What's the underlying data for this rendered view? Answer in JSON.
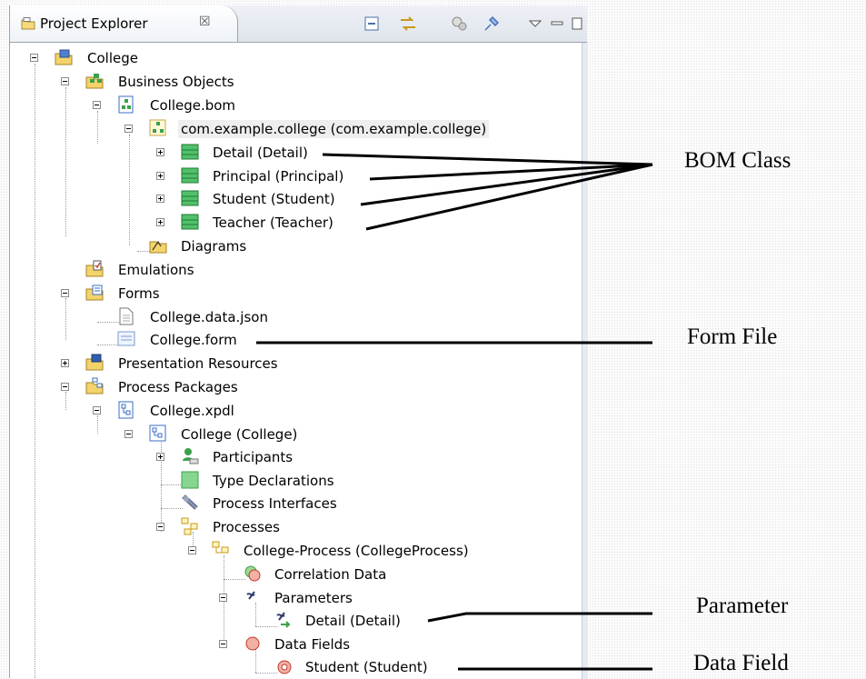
{
  "view": {
    "tab_title": "Project Explorer",
    "close_glyph": "☒"
  },
  "tree": {
    "root": "College",
    "business_objects": "Business Objects",
    "bom_file": "College.bom",
    "package": "com.example.college (com.example.college)",
    "classes": [
      "Detail (Detail)",
      "Principal (Principal)",
      "Student (Student)",
      "Teacher (Teacher)"
    ],
    "diagrams": "Diagrams",
    "emulations": "Emulations",
    "forms": "Forms",
    "data_json": "College.data.json",
    "form_file": "College.form",
    "presentation": "Presentation Resources",
    "process_packages": "Process Packages",
    "xpdl": "College.xpdl",
    "college_pkg": "College (College)",
    "participants": "Participants",
    "type_decl": "Type Declarations",
    "interfaces": "Process Interfaces",
    "processes": "Processes",
    "college_process": "College-Process (CollegeProcess)",
    "correlation": "Correlation Data",
    "parameters": "Parameters",
    "param_detail": "Detail (Detail)",
    "data_fields": "Data Fields",
    "field_student": "Student (Student)"
  },
  "callouts": {
    "bom_class": "BOM Class",
    "form_file": "Form File",
    "parameter": "Parameter",
    "data_field": "Data Field"
  }
}
